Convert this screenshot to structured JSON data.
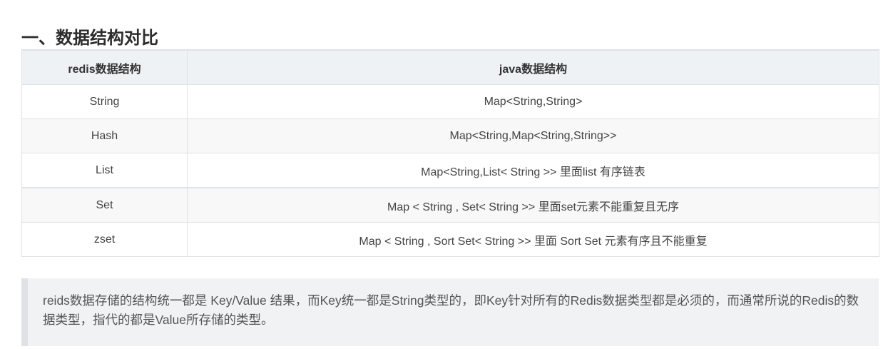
{
  "section": {
    "title": "一、数据结构对比"
  },
  "table": {
    "headers": [
      "redis数据结构",
      "java数据结构"
    ],
    "rows": [
      {
        "redis": "String",
        "java": "Map<String,String>"
      },
      {
        "redis": "Hash",
        "java": "Map<String,Map<String,String>>"
      },
      {
        "redis": "List",
        "java": "Map<String,List< String >> 里面list 有序链表"
      },
      {
        "redis": "Set",
        "java": "Map < String , Set< String >> 里面set元素不能重复且无序"
      },
      {
        "redis": "zset",
        "java": "Map < String , Sort Set< String >> 里面 Sort Set 元素有序且不能重复"
      }
    ]
  },
  "note": {
    "text": "reids数据存储的结构统一都是 Key/Value 结果，而Key统一都是String类型的，即Key针对所有的Redis数据类型都是必须的，而通常所说的Redis的数据类型，指代的都是Value所存储的类型。"
  }
}
